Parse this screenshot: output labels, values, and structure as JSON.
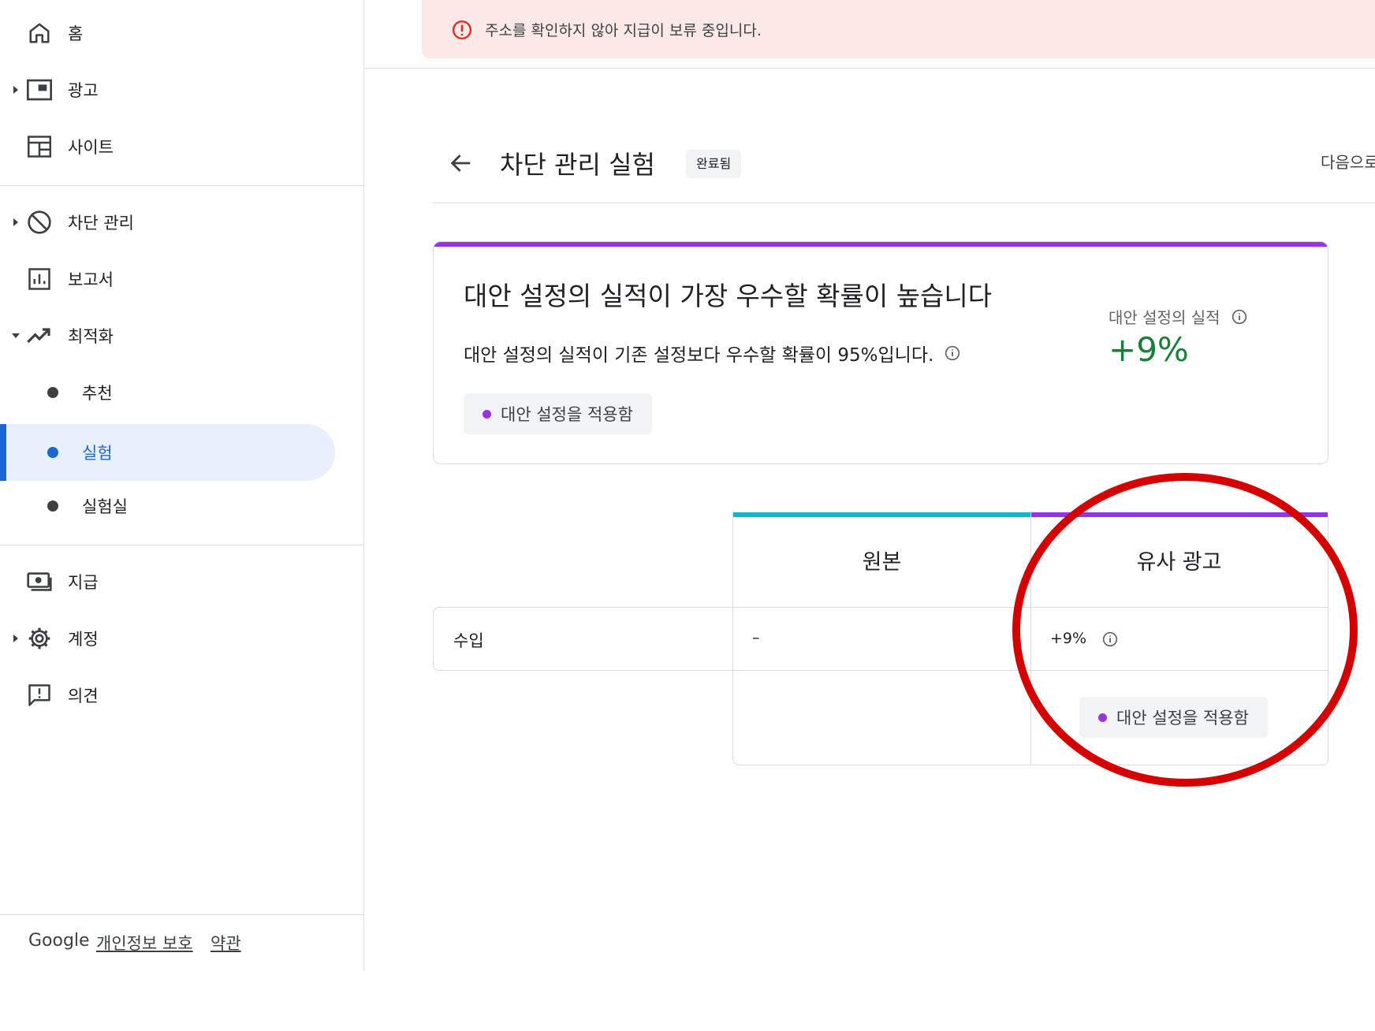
{
  "sidebar": {
    "items": [
      {
        "label": "홈",
        "icon": "home-icon"
      },
      {
        "label": "광고",
        "icon": "ads-icon"
      },
      {
        "label": "사이트",
        "icon": "sites-icon"
      },
      {
        "label": "차단 관리",
        "icon": "block-icon"
      },
      {
        "label": "보고서",
        "icon": "reports-icon"
      },
      {
        "label": "최적화",
        "icon": "trending-up-icon"
      },
      {
        "label": "추천"
      },
      {
        "label": "실험"
      },
      {
        "label": "실험실"
      },
      {
        "label": "지급",
        "icon": "payments-icon"
      },
      {
        "label": "계정",
        "icon": "gear-icon"
      },
      {
        "label": "의견",
        "icon": "feedback-icon"
      }
    ],
    "footer": {
      "brand": "Google",
      "privacy": "개인정보 보호",
      "terms": "약관"
    }
  },
  "alert": {
    "text": "주소를 확인하지 않아 지급이 보류 중입니다.",
    "color": "#d93025"
  },
  "header": {
    "title": "차단 관리 실험",
    "status_badge": "완료됨",
    "next_label": "다음으로"
  },
  "summary": {
    "headline": "대안 설정의 실적이 가장 우수할 확률이 높습니다",
    "description": "대안 설정의 실적이 기존 설정보다 우수할 확률이 95%입니다.",
    "apply_label": "대안 설정을 적용함",
    "metric_label": "대안 설정의 실적",
    "metric_value": "+9%",
    "accent": "#9334e6",
    "positive_color": "#188038"
  },
  "comparison": {
    "columns": [
      {
        "label": "원본",
        "color": "#12b5cb"
      },
      {
        "label": "유사 광고",
        "color": "#9334e6"
      }
    ],
    "rows": [
      {
        "label": "수입",
        "original": "–",
        "variant": "+9%"
      }
    ],
    "apply_label": "대안 설정을 적용함"
  },
  "annotation": {
    "color": "#d50000"
  }
}
